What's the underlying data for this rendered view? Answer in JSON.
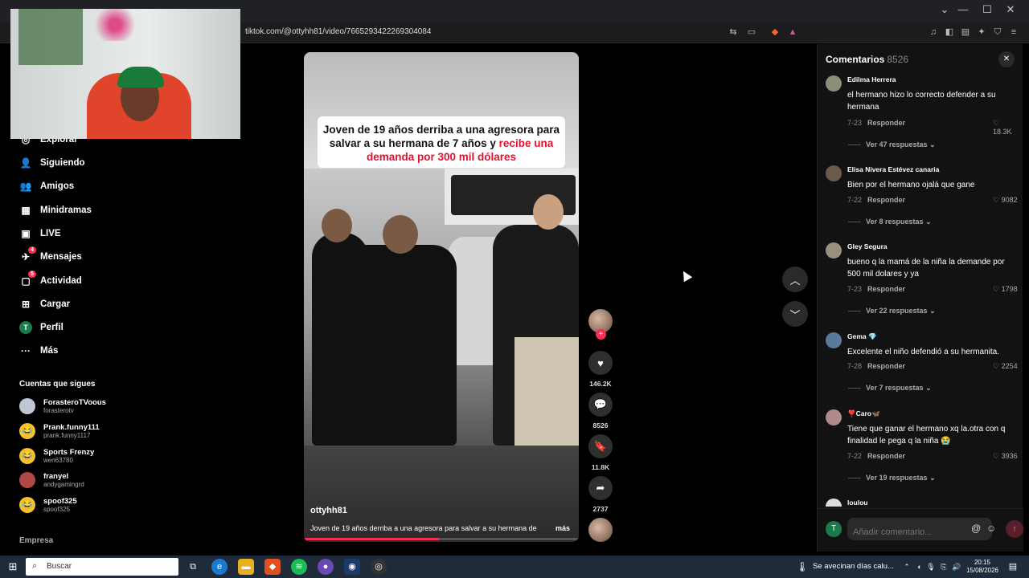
{
  "browser": {
    "url": "tiktok.com/@ottyhh81/video/7665293422269304084",
    "window_controls": [
      "⌄",
      "—",
      "☐",
      "✕"
    ]
  },
  "sidebar": {
    "items": [
      {
        "label": "Explorar",
        "icon": "compass-icon",
        "glyph": "◎"
      },
      {
        "label": "Siguiendo",
        "icon": "following-icon",
        "glyph": "👤"
      },
      {
        "label": "Amigos",
        "icon": "friends-icon",
        "glyph": "👥"
      },
      {
        "label": "Minidramas",
        "icon": "film-icon",
        "glyph": "▦"
      },
      {
        "label": "LIVE",
        "icon": "live-icon",
        "glyph": "▣"
      },
      {
        "label": "Mensajes",
        "icon": "messages-icon",
        "glyph": "✈",
        "badge": "4"
      },
      {
        "label": "Actividad",
        "icon": "activity-icon",
        "glyph": "▢",
        "badge": "5"
      },
      {
        "label": "Cargar",
        "icon": "upload-icon",
        "glyph": "⊞"
      },
      {
        "label": "Perfil",
        "icon": "profile-icon",
        "glyph": "T"
      },
      {
        "label": "Más",
        "icon": "more-icon",
        "glyph": "···"
      }
    ],
    "following_title": "Cuentas que sigues",
    "following": [
      {
        "name": "ForasteroTVoous",
        "handle": "forasterotv"
      },
      {
        "name": "Prank.funny111",
        "handle": "prank.funny1117"
      },
      {
        "name": "Sports Frenzy",
        "handle": "wen63780"
      },
      {
        "name": "franyel",
        "handle": "andygamingrd"
      },
      {
        "name": "spoof325",
        "handle": "spoof325"
      }
    ],
    "footer": "Empresa"
  },
  "video": {
    "headline_part1": "Joven de 19 años derriba a una agresora para salvar a su hermana de 7 años y",
    "headline_red": "recibe una demanda por 300 mil dólares",
    "username": "ottyhh81",
    "description": "Joven de 19 años derriba a una agresora para salvar a su hermana de",
    "more": "más",
    "progress": 0.49
  },
  "actions": {
    "likes": "146.2K",
    "comments": "8526",
    "saves": "11.8K",
    "shares": "2737"
  },
  "comments_panel": {
    "title": "Comentarios",
    "count": "8526",
    "input_placeholder": "Añadir comentario...",
    "reply_label": "Responder",
    "items": [
      {
        "name": "Edilma Herrera",
        "text": "el hermano hizo lo correcto defender a su hermana",
        "date": "7-23",
        "likes": "18.3K",
        "more": "Ver 47 respuestas"
      },
      {
        "name": "Elisa Nivera Estévez canaria",
        "text": "Bien por el hermano ojalá que gane",
        "date": "7-22",
        "likes": "9082",
        "more": "Ver 8 respuestas"
      },
      {
        "name": "Gley Segura",
        "text": "bueno q la mamá de la niña la demande por 500 mil dolares y ya",
        "date": "7-23",
        "likes": "1798",
        "more": "Ver 22 respuestas"
      },
      {
        "name": "Gema 💎",
        "text": "Excelente el niño defendió a su hermanita.",
        "date": "7-28",
        "likes": "2254",
        "more": "Ver 7 respuestas"
      },
      {
        "name": "❣️Caro🦋",
        "text": "Tiene que ganar el hermano xq la.otra con q finalidad le pega q la niña 😭",
        "date": "7-22",
        "likes": "3936",
        "more": "Ver 19 respuestas"
      },
      {
        "name": "loulou",
        "text": "",
        "date": "",
        "likes": "",
        "more": ""
      }
    ]
  },
  "taskbar": {
    "search": "Buscar",
    "weather": "Se avecinan días calu...",
    "time": "20:15",
    "date": "15/08/2026"
  }
}
